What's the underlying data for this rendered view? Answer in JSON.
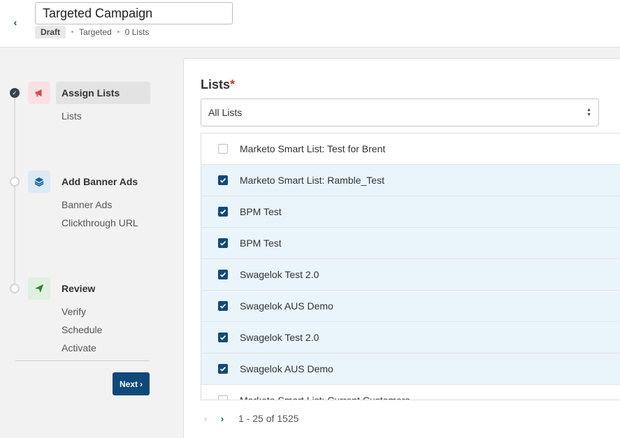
{
  "header": {
    "campaign_name": "Targeted Campaign",
    "status_badge": "Draft",
    "type": "Targeted",
    "list_count": "0 Lists"
  },
  "sidebar": {
    "steps": [
      {
        "label": "Assign Lists",
        "state": "done",
        "icon": "megaphone-icon",
        "icon_color": "#d94452",
        "icon_bg": "#f9e1e3",
        "substeps": [
          "Lists"
        ]
      },
      {
        "label": "Add Banner Ads",
        "state": "todo",
        "icon": "layers-icon",
        "icon_color": "#1a5e9e",
        "icon_bg": "#dceaf6",
        "substeps": [
          "Banner Ads",
          "Clickthrough URL"
        ]
      },
      {
        "label": "Review",
        "state": "todo",
        "icon": "paper-plane-icon",
        "icon_color": "#2e7d32",
        "icon_bg": "#dff0e0",
        "substeps": [
          "Verify",
          "Schedule",
          "Activate"
        ]
      }
    ],
    "next_label": "Next"
  },
  "main": {
    "title": "Lists",
    "required_mark": "*",
    "filter_value": "All Lists",
    "rows": [
      {
        "label": "Marketo Smart List: Test for Brent",
        "checked": false
      },
      {
        "label": "Marketo Smart List: Ramble_Test",
        "checked": true
      },
      {
        "label": "BPM Test",
        "checked": true
      },
      {
        "label": "BPM Test",
        "checked": true
      },
      {
        "label": "Swagelok Test 2.0",
        "checked": true
      },
      {
        "label": "Swagelok AUS Demo",
        "checked": true
      },
      {
        "label": "Swagelok Test 2.0",
        "checked": true
      },
      {
        "label": "Swagelok AUS Demo",
        "checked": true
      },
      {
        "label": "Marketo Smart List: Current Customers",
        "checked": false
      }
    ],
    "pagination": "1 - 25 of 1525"
  },
  "colors": {
    "primary": "#10497a",
    "selected_row": "#eaf4fb",
    "required": "#d0363d"
  }
}
